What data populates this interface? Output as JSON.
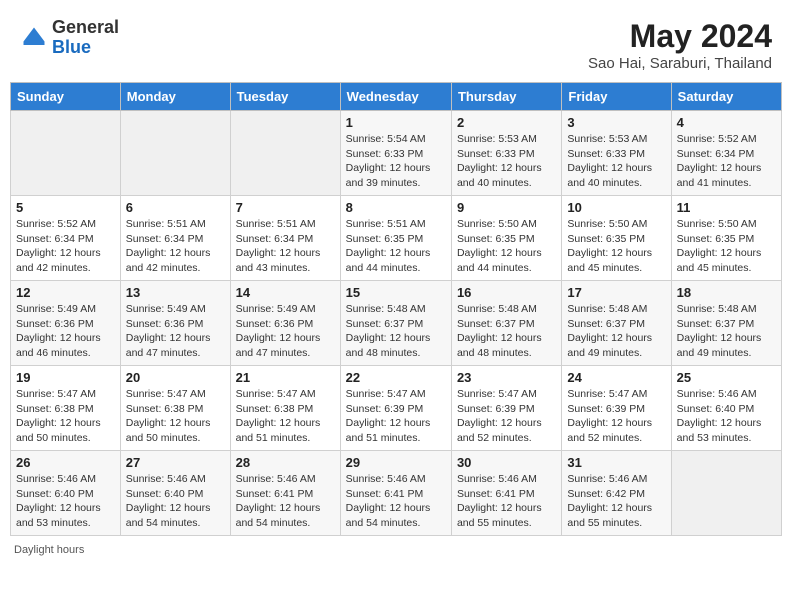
{
  "logo": {
    "general": "General",
    "blue": "Blue"
  },
  "title": "May 2024",
  "subtitle": "Sao Hai, Saraburi, Thailand",
  "days_header": [
    "Sunday",
    "Monday",
    "Tuesday",
    "Wednesday",
    "Thursday",
    "Friday",
    "Saturday"
  ],
  "weeks": [
    [
      {
        "day": "",
        "sunrise": "",
        "sunset": "",
        "daylight": ""
      },
      {
        "day": "",
        "sunrise": "",
        "sunset": "",
        "daylight": ""
      },
      {
        "day": "",
        "sunrise": "",
        "sunset": "",
        "daylight": ""
      },
      {
        "day": "1",
        "sunrise": "Sunrise: 5:54 AM",
        "sunset": "Sunset: 6:33 PM",
        "daylight": "Daylight: 12 hours and 39 minutes."
      },
      {
        "day": "2",
        "sunrise": "Sunrise: 5:53 AM",
        "sunset": "Sunset: 6:33 PM",
        "daylight": "Daylight: 12 hours and 40 minutes."
      },
      {
        "day": "3",
        "sunrise": "Sunrise: 5:53 AM",
        "sunset": "Sunset: 6:33 PM",
        "daylight": "Daylight: 12 hours and 40 minutes."
      },
      {
        "day": "4",
        "sunrise": "Sunrise: 5:52 AM",
        "sunset": "Sunset: 6:34 PM",
        "daylight": "Daylight: 12 hours and 41 minutes."
      }
    ],
    [
      {
        "day": "5",
        "sunrise": "Sunrise: 5:52 AM",
        "sunset": "Sunset: 6:34 PM",
        "daylight": "Daylight: 12 hours and 42 minutes."
      },
      {
        "day": "6",
        "sunrise": "Sunrise: 5:51 AM",
        "sunset": "Sunset: 6:34 PM",
        "daylight": "Daylight: 12 hours and 42 minutes."
      },
      {
        "day": "7",
        "sunrise": "Sunrise: 5:51 AM",
        "sunset": "Sunset: 6:34 PM",
        "daylight": "Daylight: 12 hours and 43 minutes."
      },
      {
        "day": "8",
        "sunrise": "Sunrise: 5:51 AM",
        "sunset": "Sunset: 6:35 PM",
        "daylight": "Daylight: 12 hours and 44 minutes."
      },
      {
        "day": "9",
        "sunrise": "Sunrise: 5:50 AM",
        "sunset": "Sunset: 6:35 PM",
        "daylight": "Daylight: 12 hours and 44 minutes."
      },
      {
        "day": "10",
        "sunrise": "Sunrise: 5:50 AM",
        "sunset": "Sunset: 6:35 PM",
        "daylight": "Daylight: 12 hours and 45 minutes."
      },
      {
        "day": "11",
        "sunrise": "Sunrise: 5:50 AM",
        "sunset": "Sunset: 6:35 PM",
        "daylight": "Daylight: 12 hours and 45 minutes."
      }
    ],
    [
      {
        "day": "12",
        "sunrise": "Sunrise: 5:49 AM",
        "sunset": "Sunset: 6:36 PM",
        "daylight": "Daylight: 12 hours and 46 minutes."
      },
      {
        "day": "13",
        "sunrise": "Sunrise: 5:49 AM",
        "sunset": "Sunset: 6:36 PM",
        "daylight": "Daylight: 12 hours and 47 minutes."
      },
      {
        "day": "14",
        "sunrise": "Sunrise: 5:49 AM",
        "sunset": "Sunset: 6:36 PM",
        "daylight": "Daylight: 12 hours and 47 minutes."
      },
      {
        "day": "15",
        "sunrise": "Sunrise: 5:48 AM",
        "sunset": "Sunset: 6:37 PM",
        "daylight": "Daylight: 12 hours and 48 minutes."
      },
      {
        "day": "16",
        "sunrise": "Sunrise: 5:48 AM",
        "sunset": "Sunset: 6:37 PM",
        "daylight": "Daylight: 12 hours and 48 minutes."
      },
      {
        "day": "17",
        "sunrise": "Sunrise: 5:48 AM",
        "sunset": "Sunset: 6:37 PM",
        "daylight": "Daylight: 12 hours and 49 minutes."
      },
      {
        "day": "18",
        "sunrise": "Sunrise: 5:48 AM",
        "sunset": "Sunset: 6:37 PM",
        "daylight": "Daylight: 12 hours and 49 minutes."
      }
    ],
    [
      {
        "day": "19",
        "sunrise": "Sunrise: 5:47 AM",
        "sunset": "Sunset: 6:38 PM",
        "daylight": "Daylight: 12 hours and 50 minutes."
      },
      {
        "day": "20",
        "sunrise": "Sunrise: 5:47 AM",
        "sunset": "Sunset: 6:38 PM",
        "daylight": "Daylight: 12 hours and 50 minutes."
      },
      {
        "day": "21",
        "sunrise": "Sunrise: 5:47 AM",
        "sunset": "Sunset: 6:38 PM",
        "daylight": "Daylight: 12 hours and 51 minutes."
      },
      {
        "day": "22",
        "sunrise": "Sunrise: 5:47 AM",
        "sunset": "Sunset: 6:39 PM",
        "daylight": "Daylight: 12 hours and 51 minutes."
      },
      {
        "day": "23",
        "sunrise": "Sunrise: 5:47 AM",
        "sunset": "Sunset: 6:39 PM",
        "daylight": "Daylight: 12 hours and 52 minutes."
      },
      {
        "day": "24",
        "sunrise": "Sunrise: 5:47 AM",
        "sunset": "Sunset: 6:39 PM",
        "daylight": "Daylight: 12 hours and 52 minutes."
      },
      {
        "day": "25",
        "sunrise": "Sunrise: 5:46 AM",
        "sunset": "Sunset: 6:40 PM",
        "daylight": "Daylight: 12 hours and 53 minutes."
      }
    ],
    [
      {
        "day": "26",
        "sunrise": "Sunrise: 5:46 AM",
        "sunset": "Sunset: 6:40 PM",
        "daylight": "Daylight: 12 hours and 53 minutes."
      },
      {
        "day": "27",
        "sunrise": "Sunrise: 5:46 AM",
        "sunset": "Sunset: 6:40 PM",
        "daylight": "Daylight: 12 hours and 54 minutes."
      },
      {
        "day": "28",
        "sunrise": "Sunrise: 5:46 AM",
        "sunset": "Sunset: 6:41 PM",
        "daylight": "Daylight: 12 hours and 54 minutes."
      },
      {
        "day": "29",
        "sunrise": "Sunrise: 5:46 AM",
        "sunset": "Sunset: 6:41 PM",
        "daylight": "Daylight: 12 hours and 54 minutes."
      },
      {
        "day": "30",
        "sunrise": "Sunrise: 5:46 AM",
        "sunset": "Sunset: 6:41 PM",
        "daylight": "Daylight: 12 hours and 55 minutes."
      },
      {
        "day": "31",
        "sunrise": "Sunrise: 5:46 AM",
        "sunset": "Sunset: 6:42 PM",
        "daylight": "Daylight: 12 hours and 55 minutes."
      },
      {
        "day": "",
        "sunrise": "",
        "sunset": "",
        "daylight": ""
      }
    ]
  ],
  "footer": "Daylight hours"
}
